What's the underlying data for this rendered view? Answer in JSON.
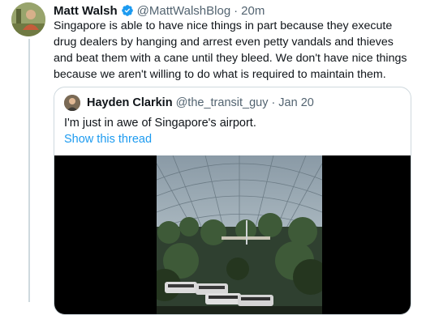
{
  "tweet": {
    "author_name": "Matt Walsh",
    "handle": "@MattWalshBlog",
    "separator": "·",
    "time": "20m",
    "text": "Singapore is able to have nice things in part because they execute drug dealers by hanging and arrest even petty vandals and thieves and beat them with a cane until they bleed. We don't have nice things because we aren't willing to do what is required to maintain them."
  },
  "quoted_tweet": {
    "author_name": "Hayden Clarkin",
    "handle": "@the_transit_guy",
    "separator": "·",
    "time": "Jan 20",
    "text": "I'm just in awe of Singapore's airport.",
    "show_thread_label": "Show this thread"
  },
  "colors": {
    "verified_blue": "#1d9bf0",
    "link_blue": "#1d9bf0",
    "secondary_text": "#536471",
    "border": "#cfd9de"
  },
  "icons": {
    "verified": "verified-badge-icon"
  }
}
